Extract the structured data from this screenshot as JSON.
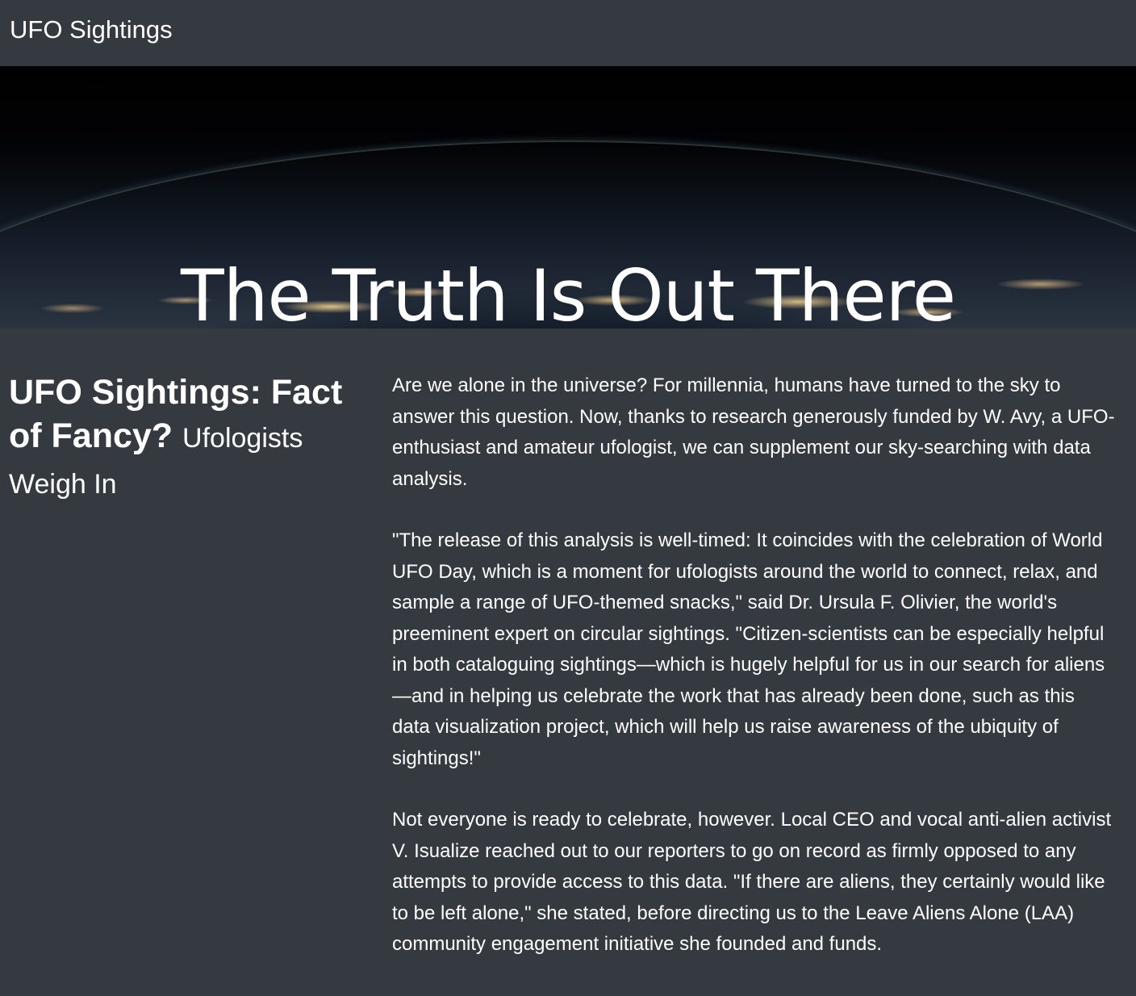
{
  "navbar": {
    "brand": "UFO Sightings"
  },
  "hero": {
    "title": "The Truth Is Out There"
  },
  "article": {
    "headline_main": "UFO Sightings: Fact of Fancy?",
    "headline_sub": "Ufologists Weigh In",
    "paragraphs": [
      "Are we alone in the universe? For millennia, humans have turned to the sky to answer this question. Now, thanks to research generously funded by W. Avy, a UFO-enthusiast and amateur ufologist, we can supplement our sky-searching with data analysis.",
      "\"The release of this analysis is well-timed: It coincides with the celebration of World UFO Day, which is a moment for ufologists around the world to connect, relax, and sample a range of UFO-themed snacks,\" said Dr. Ursula F. Olivier, the world's preeminent expert on circular sightings. \"Citizen-scientists can be especially helpful in both cataloguing sightings—which is hugely helpful for us in our search for aliens—and in helping us celebrate the work that has already been done, such as this data visualization project, which will help us raise awareness of the ubiquity of sightings!\"",
      "Not everyone is ready to celebrate, however. Local CEO and vocal anti-alien activist V. Isualize reached out to our reporters to go on record as firmly opposed to any attempts to provide access to this data. \"If there are aliens, they certainly would like to be left alone,\" she stated, before directing us to the Leave Aliens Alone (LAA) community engagement initiative she founded and funds."
    ]
  },
  "colors": {
    "background": "#343a40",
    "text": "#ffffff"
  }
}
